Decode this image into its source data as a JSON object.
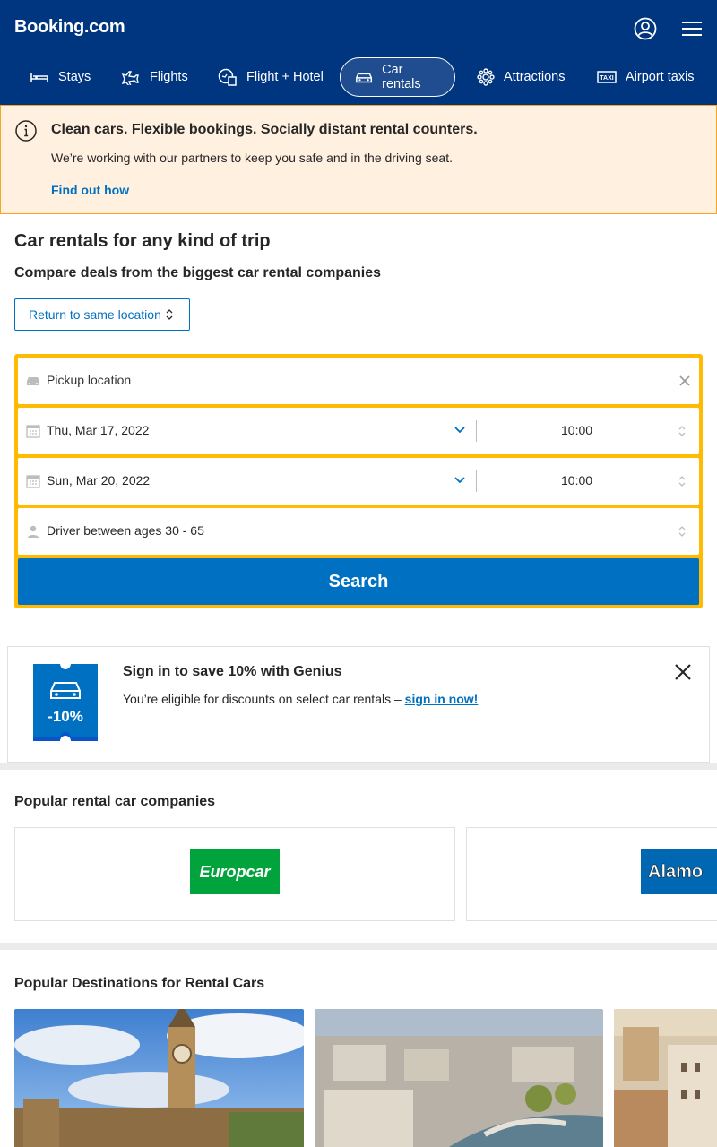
{
  "header": {
    "logo": "Booking.com",
    "nav": [
      {
        "label": "Stays",
        "icon": "bed-icon"
      },
      {
        "label": "Flights",
        "icon": "plane-icon"
      },
      {
        "label": "Flight + Hotel",
        "icon": "flight-hotel-icon"
      },
      {
        "label": "Car rentals",
        "icon": "car-icon",
        "active": true
      },
      {
        "label": "Attractions",
        "icon": "attractions-icon"
      },
      {
        "label": "Airport taxis",
        "icon": "taxi-icon"
      }
    ]
  },
  "banner": {
    "title": "Clean cars. Flexible bookings. Socially distant rental counters.",
    "text": "We’re working with our partners to keep you safe and in the driving seat.",
    "link": "Find out how"
  },
  "main": {
    "title": "Car rentals for any kind of trip",
    "subtitle": "Compare deals from the biggest car rental companies",
    "return_select": "Return to same location"
  },
  "search": {
    "pickup_placeholder": "Pickup location",
    "pickup_date": "Thu, Mar 17, 2022",
    "pickup_time": "10:00",
    "dropoff_date": "Sun, Mar 20, 2022",
    "dropoff_time": "10:00",
    "driver_age": "Driver between ages 30 - 65",
    "button": "Search"
  },
  "genius": {
    "badge": "-10%",
    "title": "Sign in to save 10% with Genius",
    "text": "You’re eligible for discounts on select car rentals –",
    "link": "sign in now!"
  },
  "companies": {
    "title": "Popular rental car companies",
    "items": [
      "Europcar",
      "Alamo"
    ]
  },
  "destinations": {
    "title": "Popular Destinations for Rental Cars"
  },
  "colors": {
    "brand": "#003580",
    "accent": "#0071c2",
    "search_border": "#febb02",
    "banner_bg": "#fff0e0"
  }
}
